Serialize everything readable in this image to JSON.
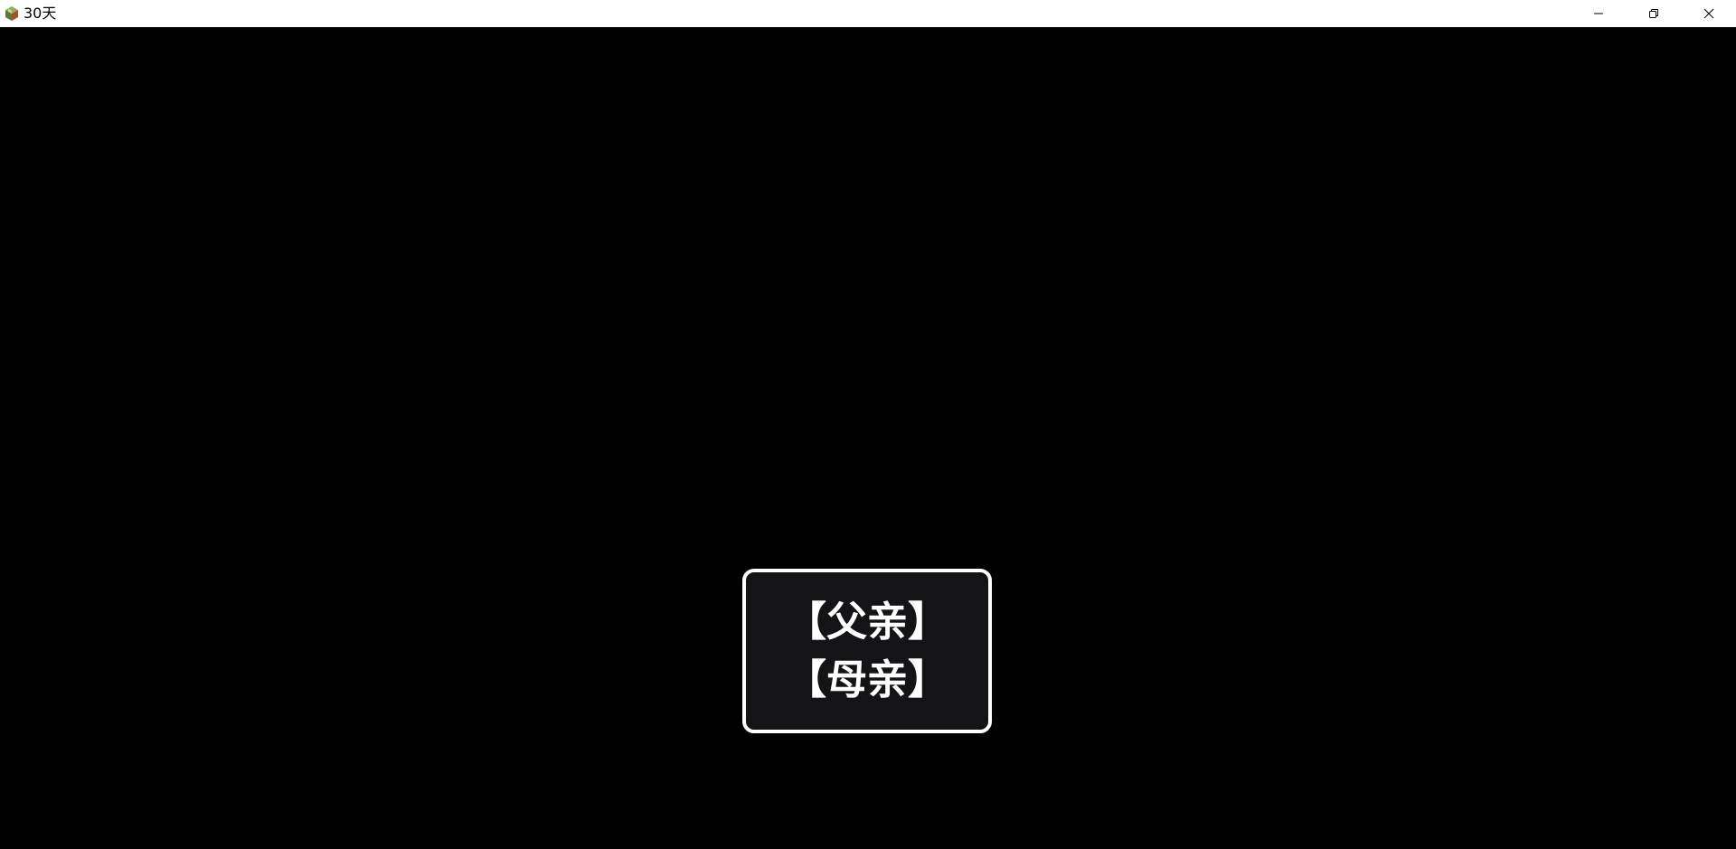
{
  "window": {
    "title": "30天",
    "icon": "game-app-icon",
    "controls": {
      "minimize_icon": "minimize-icon",
      "restore_icon": "restore-icon",
      "close_icon": "close-icon"
    }
  },
  "game": {
    "background_color": "#000000",
    "choice_window_fill": "#141316",
    "choice_window_border": "#ffffff",
    "choices": [
      {
        "label": "【父亲】"
      },
      {
        "label": "【母亲】"
      }
    ]
  }
}
